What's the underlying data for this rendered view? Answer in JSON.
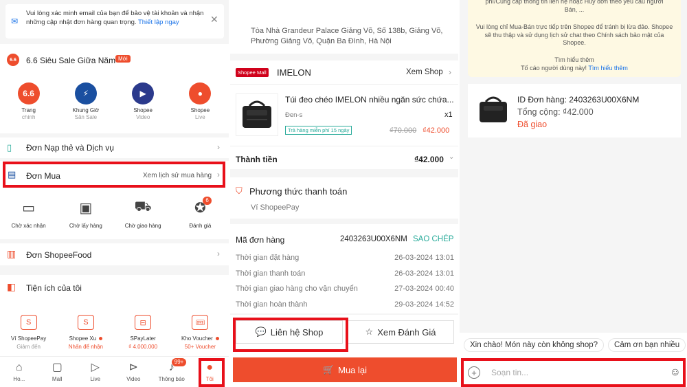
{
  "panel1": {
    "email_notice": "Vui lòng xác minh email của bạn để bảo vệ tài khoản và nhận những cập nhật đơn hàng quan trọng.",
    "email_link": "Thiết lập ngay",
    "sale_title": "6.6 Siêu Sale Giữa Năm",
    "sale_badge": "Mới",
    "sale_items": [
      {
        "label": "Trang",
        "sub": "chính",
        "glyph": "6.6",
        "color": "#ee4d2d"
      },
      {
        "label": "Khung Giờ",
        "sub": "Săn Sale",
        "glyph": "⚡",
        "color": "#1a4fa0"
      },
      {
        "label": "Shopee",
        "sub": "Video",
        "glyph": "▶",
        "color": "#2b3a8c"
      },
      {
        "label": "Shopee",
        "sub": "Live",
        "glyph": "●",
        "color": "#ee4d2d"
      }
    ],
    "topup_label": "Đơn Nạp thẻ và Dịch vụ",
    "orders_label": "Đơn Mua",
    "orders_history": "Xem lịch sử mua hàng",
    "order_status": [
      {
        "label": "Chờ xác nhận",
        "icon": "wallet-icon"
      },
      {
        "label": "Chờ lấy hàng",
        "icon": "box-icon"
      },
      {
        "label": "Chờ giao hàng",
        "icon": "truck-icon"
      },
      {
        "label": "Đánh giá",
        "icon": "star-icon",
        "badge": "6"
      }
    ],
    "food_label": "Đơn ShopeeFood",
    "utilities_label": "Tiện ích của tôi",
    "utilities": [
      {
        "label": "Ví ShopeePay",
        "sub": "Giảm đến",
        "glyph": "S"
      },
      {
        "label": "Shopee Xu",
        "sub": "Nhấn để nhận",
        "glyph": "S",
        "dot": true
      },
      {
        "label": "SPayLater",
        "sub": "₫ 4.000.000",
        "glyph": "⊟"
      },
      {
        "label": "Kho Voucher",
        "sub": "50+ Voucher",
        "glyph": "🎟",
        "dot": true
      }
    ],
    "bottom_nav": [
      {
        "label": "Ho...",
        "icon": "home-icon"
      },
      {
        "label": "Mall",
        "icon": "mall-icon"
      },
      {
        "label": "Live",
        "icon": "live-icon"
      },
      {
        "label": "Video",
        "icon": "video-icon"
      },
      {
        "label": "Thông báo",
        "icon": "bell-icon",
        "badge": "99+"
      },
      {
        "label": "Tôi",
        "icon": "user-icon"
      }
    ]
  },
  "panel2": {
    "address": "Tòa Nhà Grandeur Palace Giảng Võ, Số 138b, Giảng Võ, Phường Giảng Võ, Quận Ba Đình, Hà Nội",
    "mall_badge": "Shopee Mall",
    "shop_name": "IMELON",
    "view_shop": "Xem Shop",
    "product_name": "Túi đeo chéo IMELON nhiều ngăn sức chứa...",
    "variant": "Đen-s",
    "qty": "x1",
    "return_tag": "Trả hàng miễn phí 15 ngày",
    "old_price": "₫70.000",
    "new_price": "₫42.000",
    "total_label": "Thành tiền",
    "total_value": "₫42.000",
    "payment_title": "Phương thức thanh toán",
    "payment_method": "Ví ShopeePay",
    "order_id_label": "Mã đơn hàng",
    "order_id": "2403263U00X6NM",
    "copy_label": "SAO CHÉP",
    "times": [
      {
        "label": "Thời gian đặt hàng",
        "value": "26-03-2024 13:01"
      },
      {
        "label": "Thời gian thanh toán",
        "value": "26-03-2024 13:01"
      },
      {
        "label": "Thời gian giao hàng cho vận chuyển",
        "value": "27-03-2024 00:40"
      },
      {
        "label": "Thời gian hoàn thành",
        "value": "29-03-2024 14:52"
      }
    ],
    "contact_shop": "Liên hệ Shop",
    "view_review": "Xem Đánh Giá",
    "buy_again": "Mua lại"
  },
  "panel3": {
    "notice_top": "phí/Cung cấp thông tin liên hệ hoặc Hủy đơn theo yêu cầu người Bán, ...",
    "notice_mid": "Vui lòng chỉ Mua-Bán trực tiếp trên Shopee để tránh bị lừa đảo. Shopee sẽ thu thập và sử dụng lịch sử chat theo Chính sách bảo mật của Shopee.",
    "learn_more": "Tìm hiểu thêm",
    "report_text": "Tố cáo người dùng này!",
    "report_link": "Tìm hiểu thêm",
    "card_order_id": "ID Đơn hàng: 2403263U00X6NM",
    "card_total": "Tổng cộng: ₫42.000",
    "card_status": "Đã giao",
    "quick_replies": [
      "Xin chào! Món này còn không shop?",
      "Cảm ơn bạn nhiều"
    ],
    "input_placeholder": "Soạn tin..."
  },
  "colors": {
    "accent": "#ee4d2d",
    "highlight": "#e8101a",
    "teal": "#26aa99",
    "link": "#1a73e8"
  }
}
